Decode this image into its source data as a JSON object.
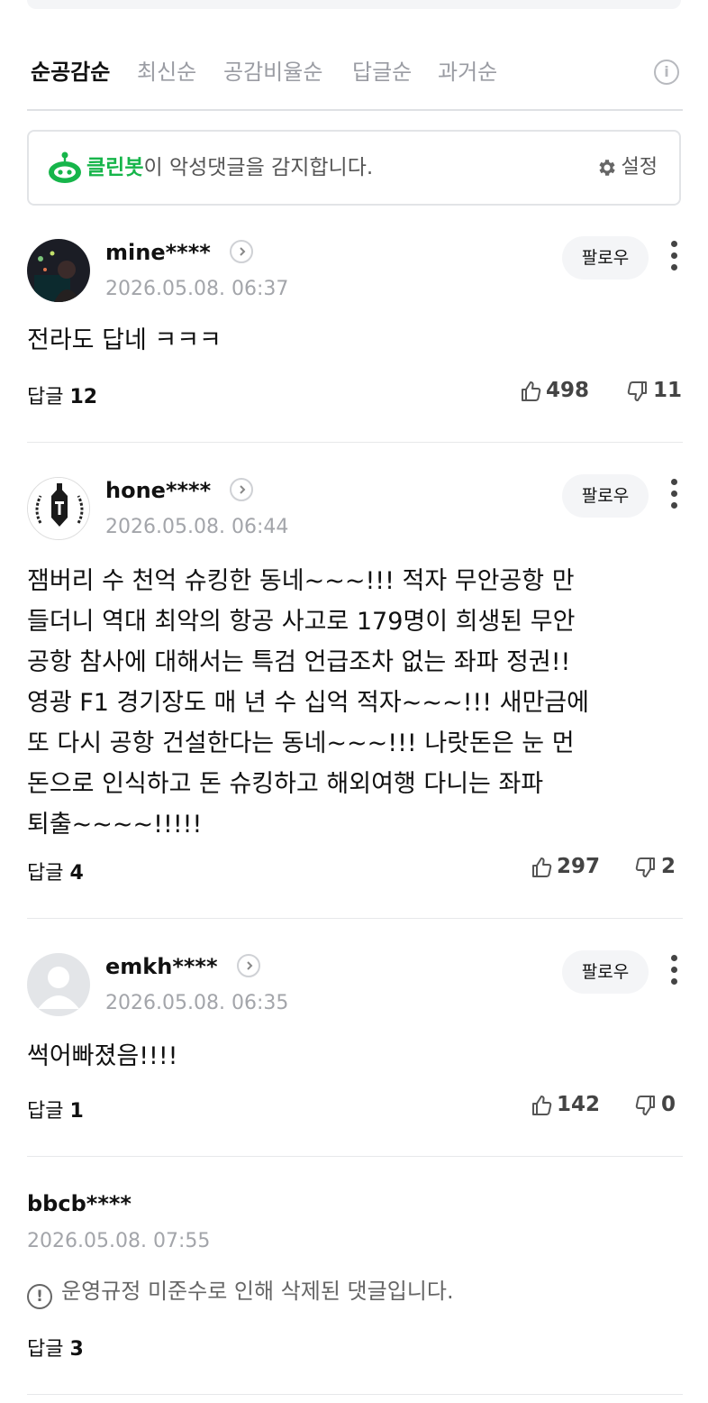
{
  "sort_tabs": [
    "순공감순",
    "최신순",
    "공감비율순",
    "답글순",
    "과거순"
  ],
  "info_icon": "info-icon",
  "cleanbot": {
    "brand": "클린봇",
    "message": "이 악성댓글을 감지합니다.",
    "settings_label": "설정",
    "brand_color": "#16b54a"
  },
  "comments": [
    {
      "nickname": "mine****",
      "date": "2026.05.08. 06:37",
      "follow_label": "팔로우",
      "text": "전라도 답네 ㅋㅋㅋ",
      "reply_label": "답글",
      "reply_count": "12",
      "likes": "498",
      "dislikes": "11"
    },
    {
      "nickname": "hone****",
      "date": "2026.05.08. 06:44",
      "follow_label": "팔로우",
      "text": "잼버리 수 천억 슈킹한 동네~~~!!! 적자 무안공항 만\n들더니 역대 최악의 항공 사고로 179명이 희생된 무안\n공항 참사에 대해서는 특검 언급조차 없는 좌파 정권!!\n영광 F1 경기장도 매 년 수 십억 적자~~~!!! 새만금에\n또 다시 공항 건설한다는 동네~~~!!! 나랏돈은 눈 먼\n돈으로 인식하고 돈 슈킹하고 해외여행 다니는 좌파\n퇴출~~~~!!!!!",
      "reply_label": "답글",
      "reply_count": "4",
      "likes": "297",
      "dislikes": "2"
    },
    {
      "nickname": "emkh****",
      "date": "2026.05.08. 06:35",
      "follow_label": "팔로우",
      "text": "썩어빠졌음!!!!",
      "reply_label": "답글",
      "reply_count": "1",
      "likes": "142",
      "dislikes": "0"
    }
  ],
  "deleted_comment": {
    "nickname": "bbcb****",
    "date": "2026.05.08. 07:55",
    "notice": "운영규정 미준수로 인해 삭제된 댓글입니다.",
    "reply_label": "답글",
    "reply_count": "3"
  }
}
